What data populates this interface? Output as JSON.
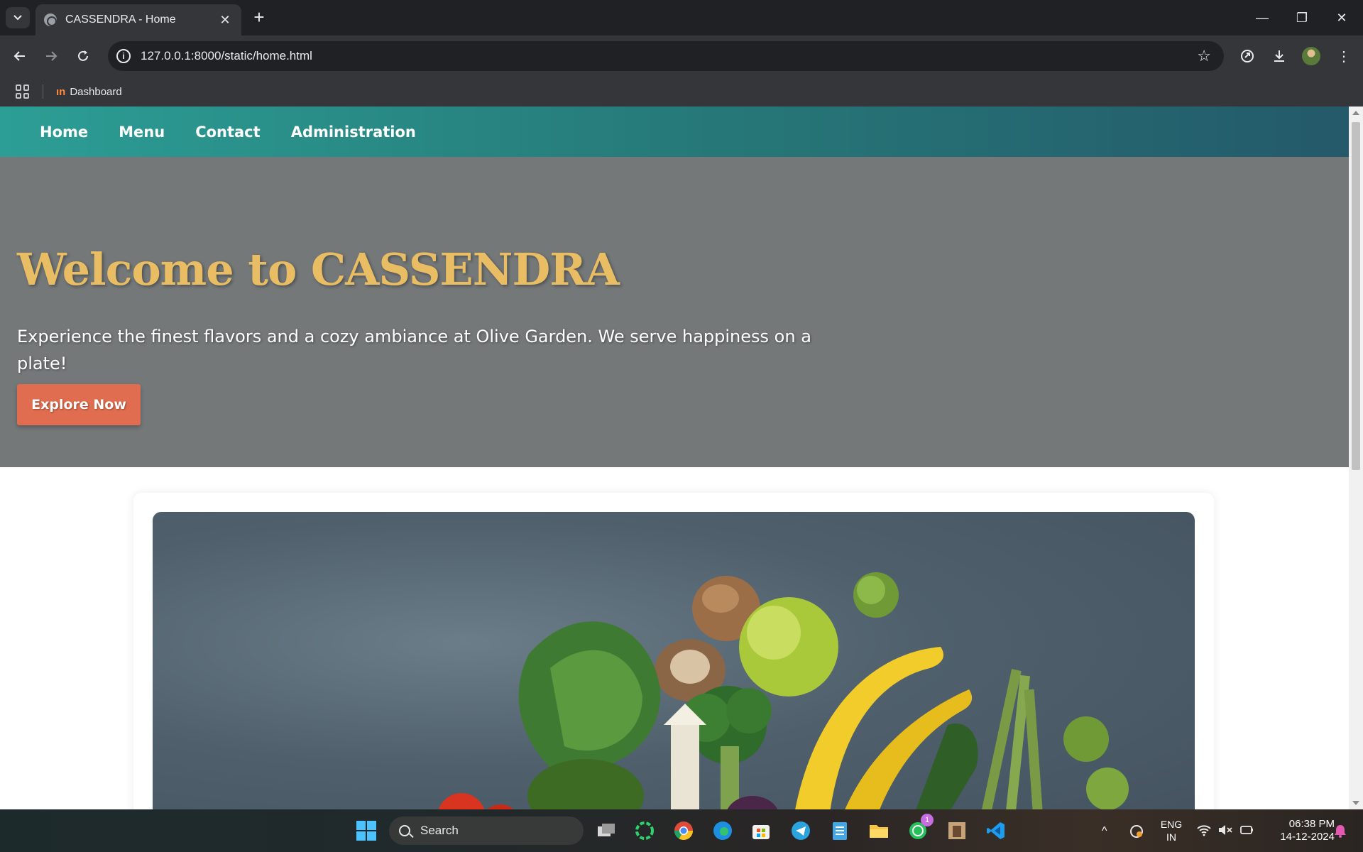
{
  "browser": {
    "tab_title": "CASSENDRA - Home",
    "url": "127.0.0.1:8000/static/home.html",
    "bookmarks": [
      {
        "label": "Dashboard"
      }
    ]
  },
  "site": {
    "nav": [
      "Home",
      "Menu",
      "Contact",
      "Administration"
    ],
    "hero": {
      "title": "Welcome to CASSENDRA",
      "subtitle": "Experience the finest flavors and a cozy ambiance at Olive Garden. We serve happiness on a plate!",
      "cta": "Explore Now"
    }
  },
  "taskbar": {
    "search_placeholder": "Search",
    "whatsapp_badge": "1",
    "language": "ENG",
    "region": "IN",
    "time": "06:38 PM",
    "date": "14-12-2024"
  },
  "colors": {
    "nav_gradient_start": "#2c9e95",
    "nav_gradient_end": "#24596a",
    "hero_background": "#747878",
    "hero_title": "#e9bd63",
    "cta_background": "#e06d4f"
  }
}
